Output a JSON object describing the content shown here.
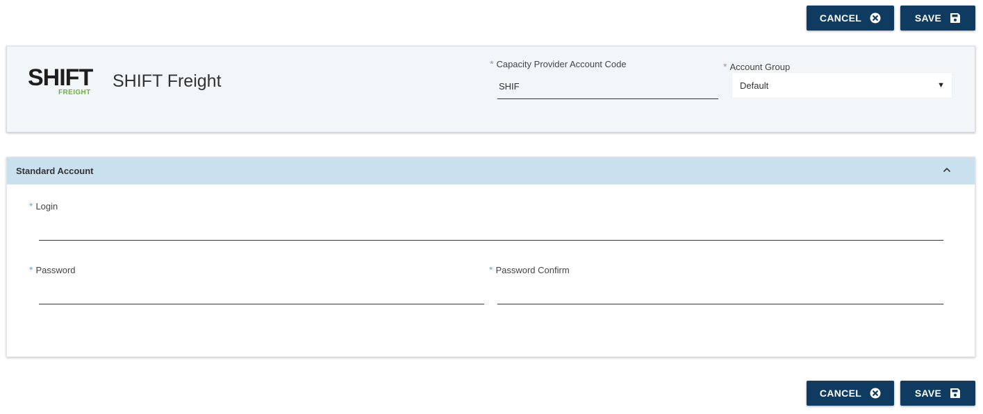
{
  "actions": {
    "cancel_label": "CANCEL",
    "save_label": "SAVE"
  },
  "header": {
    "logo_text": "SHIFT",
    "logo_subtext": "FREIGHT",
    "company_name": "SHIFT Freight",
    "account_code": {
      "required_marker": "*",
      "label": "Capacity Provider Account Code",
      "value": "SHIF"
    },
    "account_group": {
      "required_marker": "*",
      "label": "Account Group",
      "selected": "Default"
    }
  },
  "section": {
    "title": "Standard Account",
    "expanded": true,
    "login": {
      "required_marker": "*",
      "label": "Login",
      "value": ""
    },
    "password": {
      "required_marker": "*",
      "label": "Password",
      "value": ""
    },
    "password_confirm": {
      "required_marker": "*",
      "label": "Password Confirm",
      "value": ""
    }
  },
  "icons": {
    "cancel": "close-circle-icon",
    "save": "floppy-disk-icon",
    "dropdown": "caret-down-icon",
    "collapse": "chevron-up-icon"
  },
  "colors": {
    "button_bg": "#0f3b61",
    "header_card_bg": "#f3f6f9",
    "section_header_bg": "#c9e0ee",
    "required_marker": "#7da3c5",
    "logo_accent": "#6cb33f"
  }
}
